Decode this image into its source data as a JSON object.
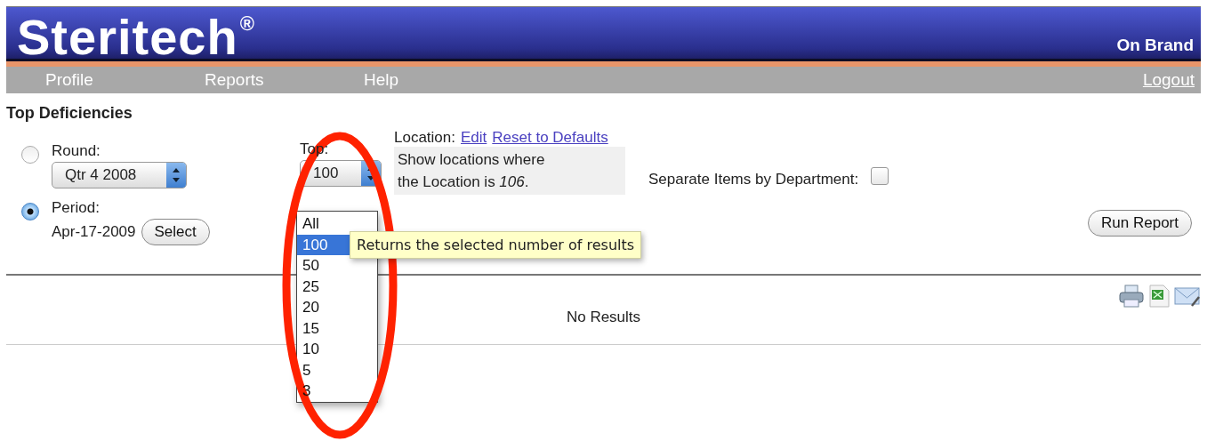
{
  "header": {
    "logo": "Steritech",
    "logo_mark": "®",
    "account": "On Brand"
  },
  "nav": {
    "items": [
      {
        "label": "Profile"
      },
      {
        "label": "Reports"
      },
      {
        "label": "Help"
      }
    ],
    "logout": "Logout"
  },
  "page_title": "Top Deficiencies",
  "round": {
    "label": "Round:",
    "selected": false,
    "value": "Qtr 4 2008"
  },
  "period": {
    "label": "Period:",
    "selected": true,
    "date": "Apr-17-2009",
    "button": "Select"
  },
  "top": {
    "label": "Top:",
    "value": "100",
    "tooltip": "Returns the selected number of results",
    "options": [
      {
        "label": "All",
        "selected": false
      },
      {
        "label": "100",
        "selected": true
      },
      {
        "label": "50",
        "selected": false
      },
      {
        "label": "25",
        "selected": false
      },
      {
        "label": "20",
        "selected": false
      },
      {
        "label": "15",
        "selected": false
      },
      {
        "label": "10",
        "selected": false
      },
      {
        "label": "5",
        "selected": false
      },
      {
        "label": "3",
        "selected": false
      }
    ]
  },
  "location": {
    "label": "Location:",
    "links": [
      "Edit",
      "Reset to Defaults"
    ],
    "description": [
      "Show locations where",
      "the Location is *106*."
    ]
  },
  "separate": {
    "label": "Separate Items by Department:",
    "checked": false
  },
  "run_button": "Run Report",
  "results": {
    "message": "No Results"
  }
}
